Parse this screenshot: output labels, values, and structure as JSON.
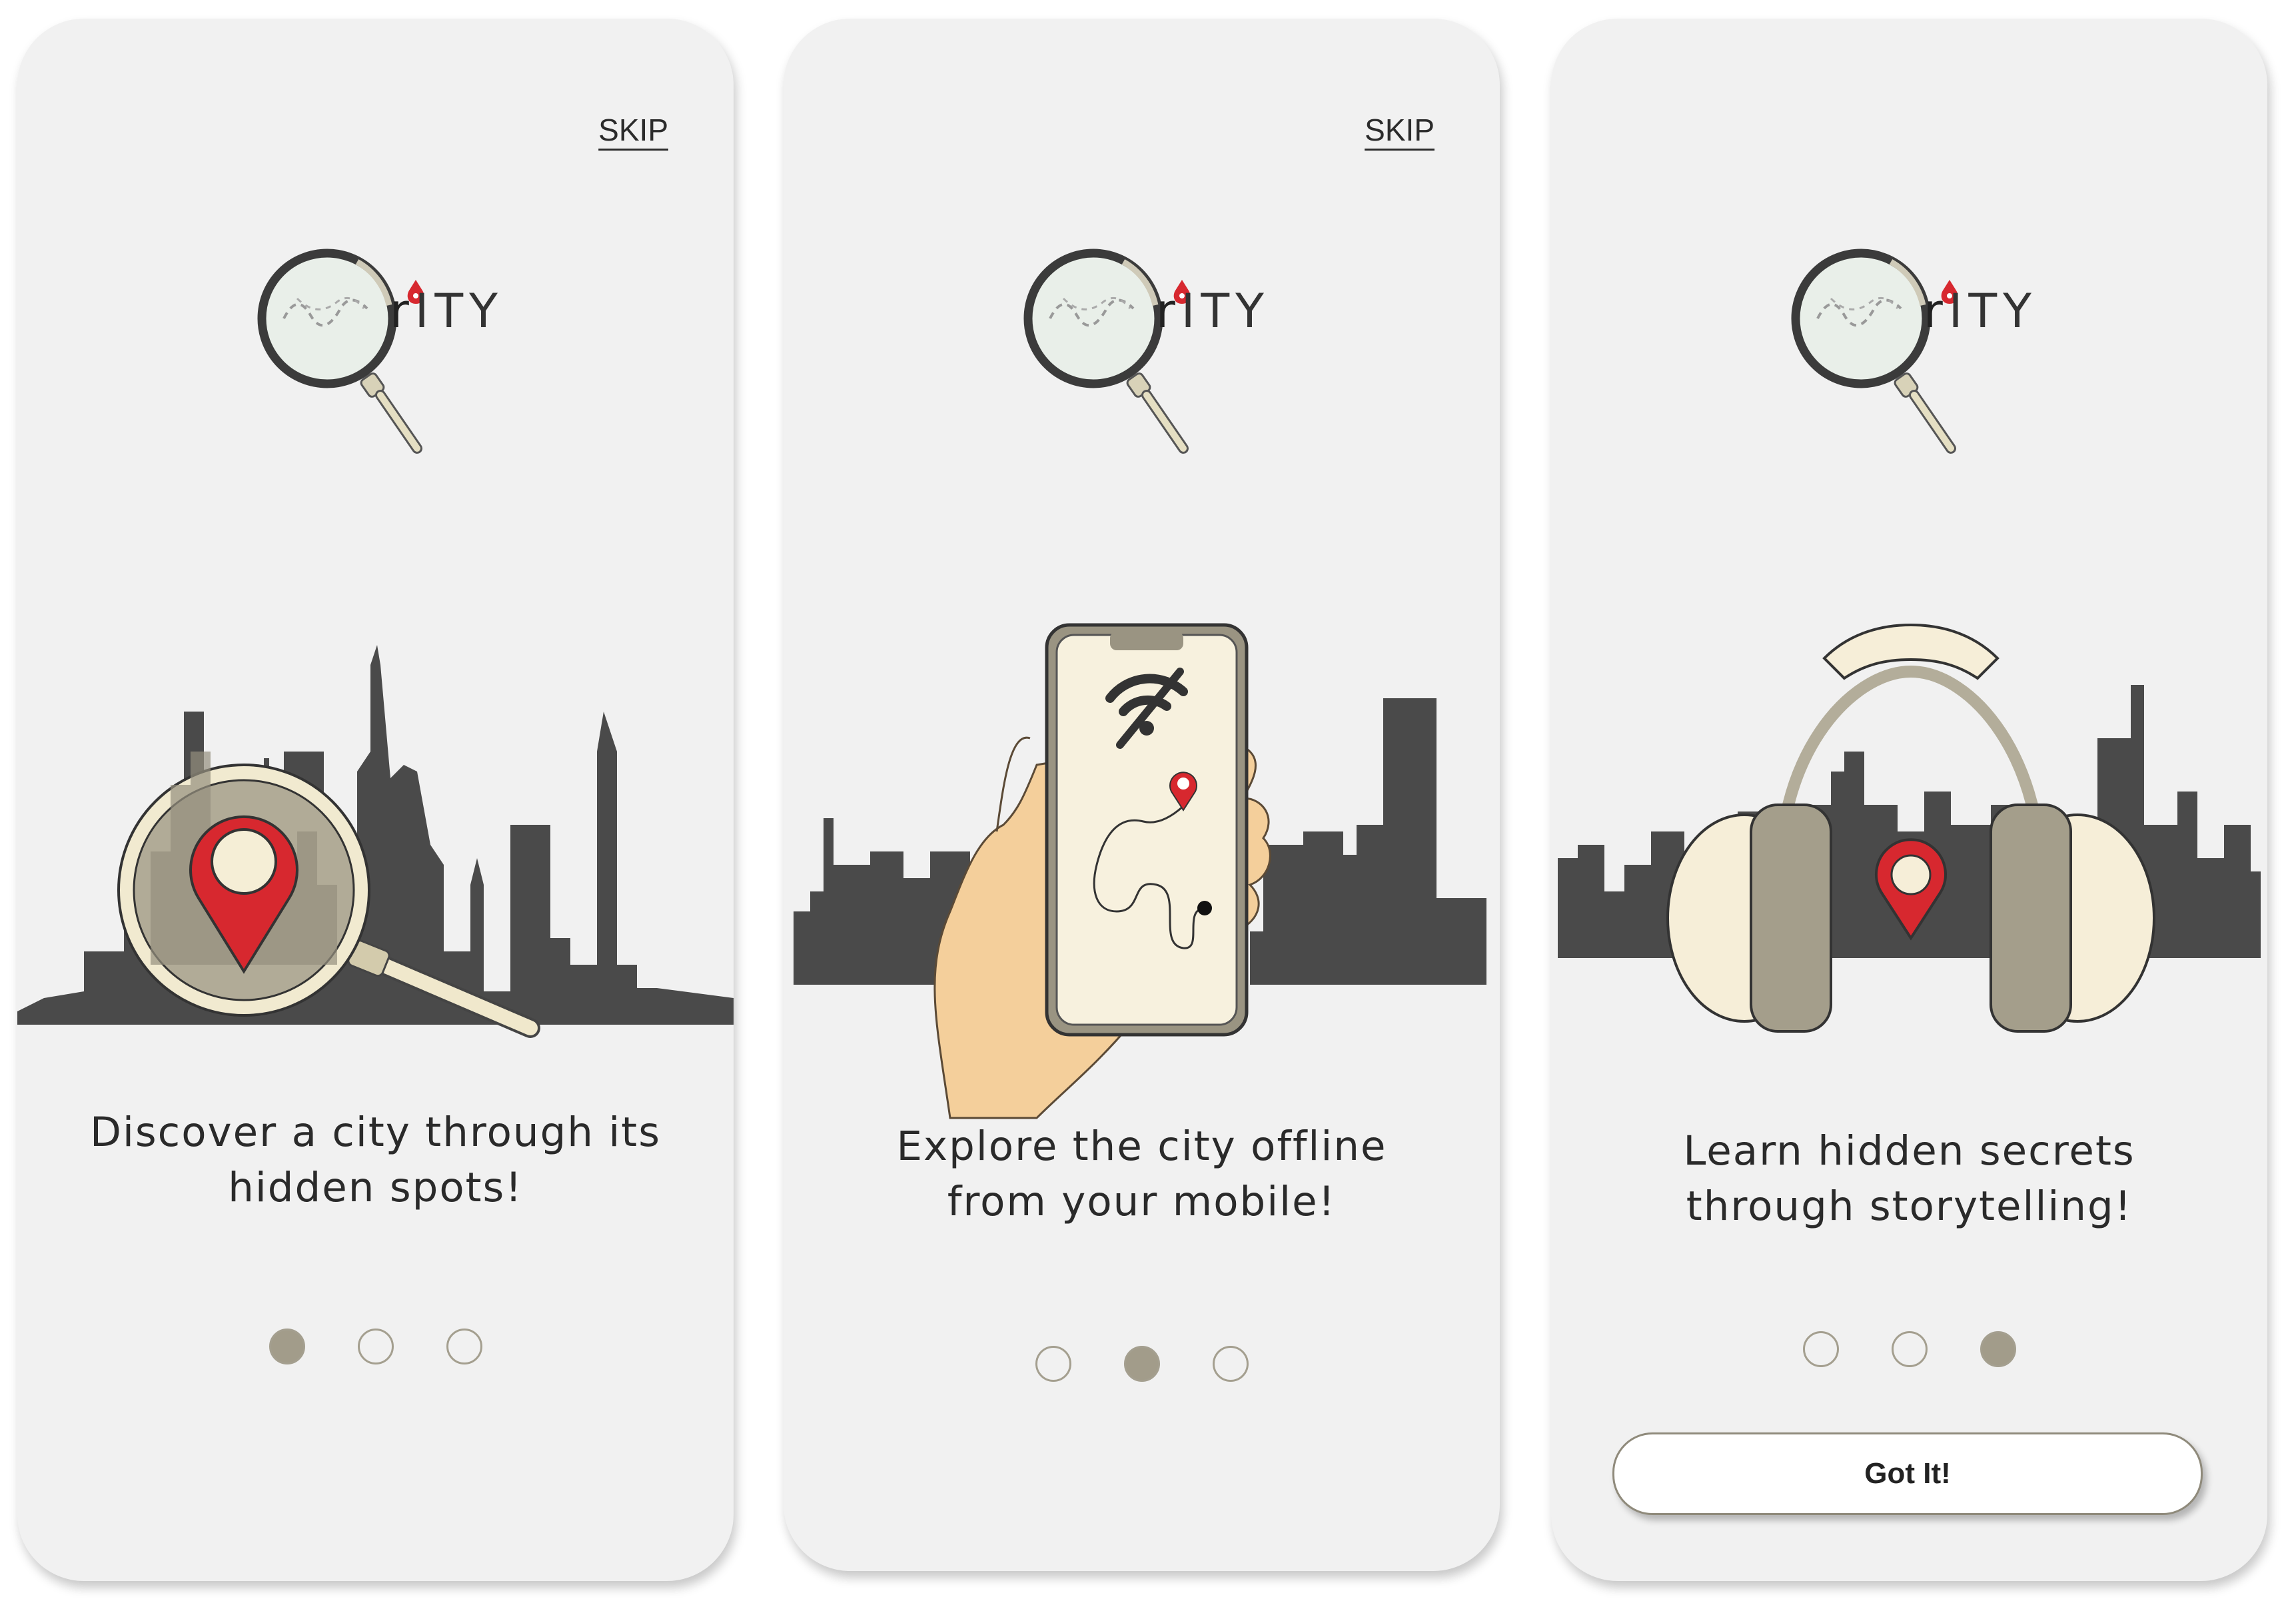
{
  "app": {
    "logo_text_r": "r",
    "logo_text_rest": "ITY"
  },
  "colors": {
    "pin_red": "#d7282f",
    "skyline": "#4a4a4a",
    "cream": "#f7f1de",
    "dot": "#a29c8a",
    "taupe": "#a49f8f"
  },
  "screens": [
    {
      "skip_label": "SKIP",
      "caption_line1": "Discover a city through its",
      "caption_line2": "hidden spots!",
      "illustration": "magnifier-pin-skyline",
      "page_indicator": {
        "current": 1,
        "total": 3
      }
    },
    {
      "skip_label": "SKIP",
      "caption_line1": "Explore the city offline",
      "caption_line2": "from your mobile!",
      "illustration": "phone-offline-map",
      "page_indicator": {
        "current": 2,
        "total": 3
      }
    },
    {
      "caption_line1": "Learn hidden secrets",
      "caption_line2": "through storytelling!",
      "illustration": "headphones-skyline",
      "page_indicator": {
        "current": 3,
        "total": 3
      },
      "got_it_label": "Got It!"
    }
  ]
}
